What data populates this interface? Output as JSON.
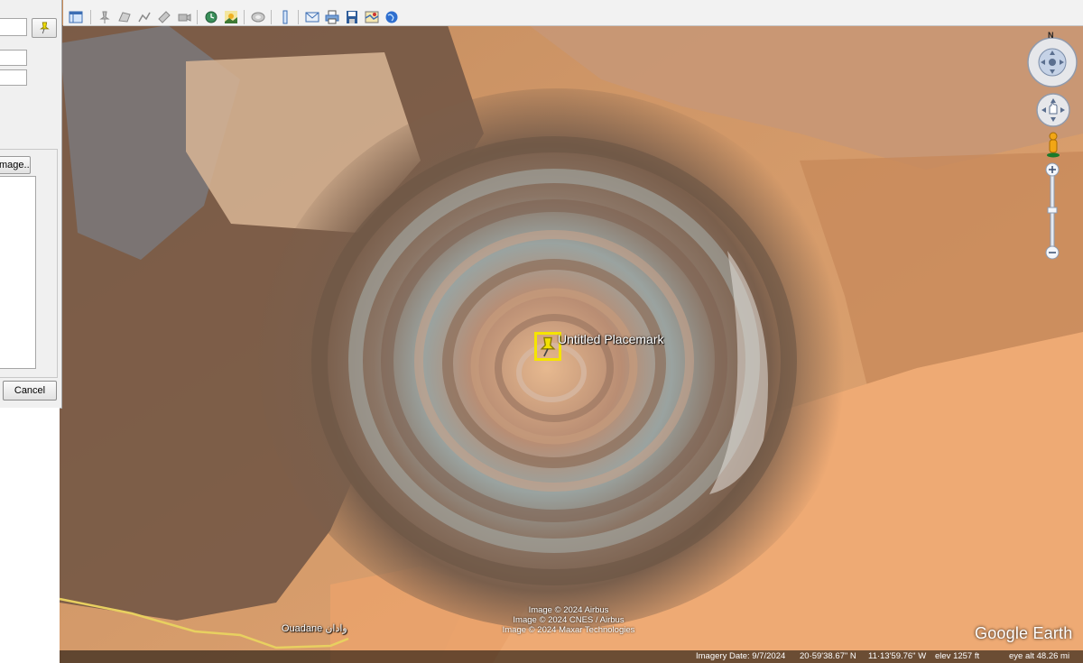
{
  "toolbar": {
    "buttons": [
      {
        "name": "sidebar-toggle-icon"
      },
      {
        "name": "add-placemark-icon"
      },
      {
        "name": "add-polygon-icon"
      },
      {
        "name": "add-path-icon"
      },
      {
        "name": "add-image-overlay-icon"
      },
      {
        "name": "record-tour-icon"
      },
      {
        "name": "historical-imagery-icon"
      },
      {
        "name": "sunlight-icon"
      },
      {
        "name": "switch-to-sky-icon"
      },
      {
        "name": "ruler-icon"
      },
      {
        "name": "email-icon"
      },
      {
        "name": "print-icon"
      },
      {
        "name": "save-image-icon"
      },
      {
        "name": "view-in-maps-icon"
      },
      {
        "name": "earth-gallery-icon"
      }
    ]
  },
  "dialog": {
    "image_button_label": "mage...",
    "cancel_label": "Cancel"
  },
  "map": {
    "placemark_label": "Untitled Placemark",
    "place_label": "Ouadane وادان",
    "attribution": [
      "Image © 2024 Airbus",
      "Image © 2024 CNES / Airbus",
      "Image © 2024 Maxar Technologies"
    ],
    "logo": "Google Earth"
  },
  "navigation": {
    "compass_north": "N"
  },
  "status": {
    "imagery_date": "Imagery Date: 9/7/2024",
    "latitude": "20·59'38.67\" N",
    "longitude": "11·13'59.76\" W",
    "elevation": "elev  1257 ft",
    "eye_altitude": "eye alt  48.26 mi"
  },
  "colors": {
    "placemark_highlight": "#f5e400",
    "road": "#e8d060",
    "desert": "#d99a62"
  }
}
